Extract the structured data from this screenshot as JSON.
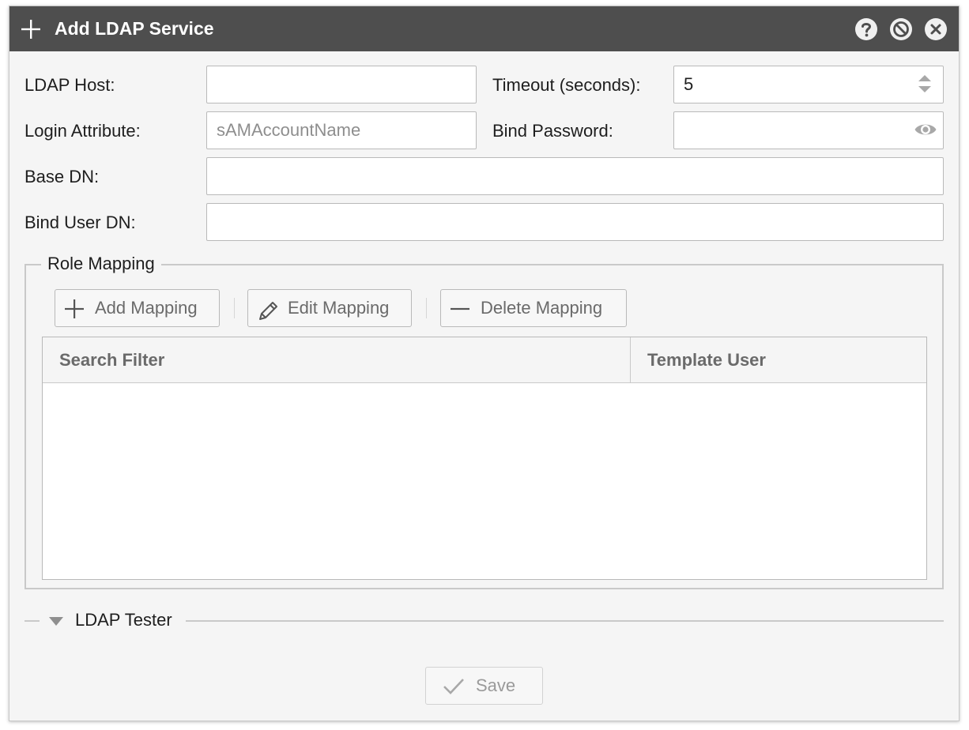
{
  "window": {
    "title": "Add LDAP Service"
  },
  "form": {
    "ldap_host": {
      "label": "LDAP Host:",
      "value": ""
    },
    "timeout": {
      "label": "Timeout (seconds):",
      "value": "5"
    },
    "login_attribute": {
      "label": "Login Attribute:",
      "value": "",
      "placeholder": "sAMAccountName"
    },
    "bind_password": {
      "label": "Bind Password:",
      "value": ""
    },
    "base_dn": {
      "label": "Base DN:",
      "value": ""
    },
    "bind_user_dn": {
      "label": "Bind User DN:",
      "value": ""
    }
  },
  "role_mapping": {
    "legend": "Role Mapping",
    "toolbar": {
      "add_label": "Add Mapping",
      "edit_label": "Edit Mapping",
      "delete_label": "Delete Mapping"
    },
    "columns": [
      "Search Filter",
      "Template User"
    ],
    "rows": []
  },
  "ldap_tester": {
    "label": "LDAP Tester",
    "collapsed": true
  },
  "footer": {
    "save_label": "Save"
  },
  "colors": {
    "titlebar": "#4e4e4e",
    "window_bg": "#f5f5f5",
    "disabled_text": "#9a9a9a"
  }
}
